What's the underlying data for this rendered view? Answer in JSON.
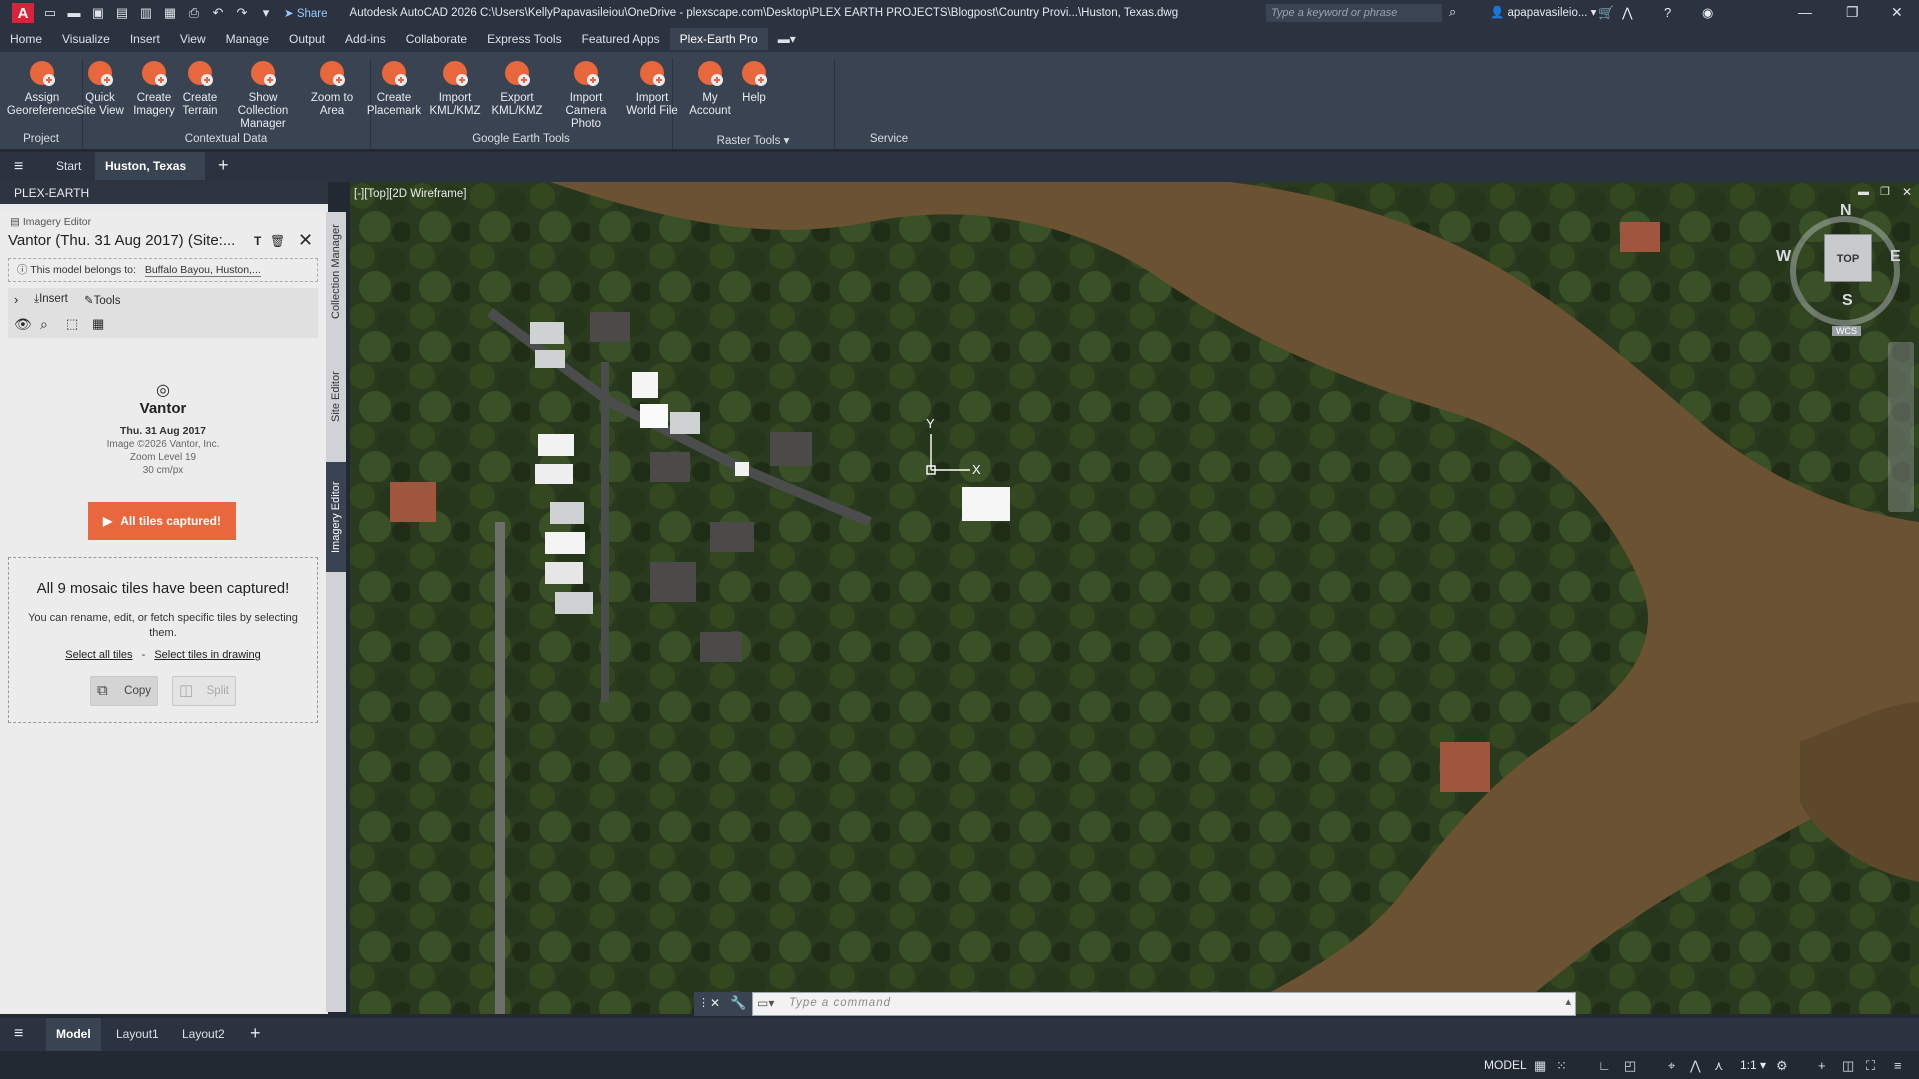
{
  "titlebar": {
    "share_label": "Share",
    "app_title": "Autodesk AutoCAD 2026   C:\\Users\\KellyPapavasileiou\\OneDrive - plexscape.com\\Desktop\\PLEX EARTH PROJECTS\\Blogpost\\Country Provi...\\Huston, Texas.dwg",
    "search_placeholder": "Type a keyword or phrase",
    "user_name": "apapavasileio..."
  },
  "ribbon_tabs": [
    "Home",
    "Visualize",
    "Insert",
    "View",
    "Manage",
    "Output",
    "Add-ins",
    "Collaborate",
    "Express Tools",
    "Featured Apps",
    "Plex-Earth Pro"
  ],
  "ribbon_active_tab": "Plex-Earth Pro",
  "ribbon": {
    "buttons": [
      {
        "l1": "Assign",
        "l2": "Georeference",
        "icon": "georeference-icon"
      },
      {
        "l1": "Quick",
        "l2": "Site View",
        "icon": "site-view-icon"
      },
      {
        "l1": "Create",
        "l2": "Imagery",
        "icon": "imagery-icon"
      },
      {
        "l1": "Create",
        "l2": "Terrain",
        "icon": "terrain-icon"
      },
      {
        "l1": "Show Collection",
        "l2": "Manager",
        "icon": "collection-manager-icon"
      },
      {
        "l1": "Zoom to",
        "l2": "Area",
        "icon": "zoom-area-icon"
      },
      {
        "l1": "Create",
        "l2": "Placemark",
        "icon": "placemark-icon"
      },
      {
        "l1": "Import",
        "l2": "KML/KMZ",
        "icon": "import-kml-icon"
      },
      {
        "l1": "Export",
        "l2": "KML/KMZ",
        "icon": "export-kml-icon"
      },
      {
        "l1": "Import",
        "l2": "Camera Photo",
        "icon": "camera-photo-icon"
      },
      {
        "l1": "Import",
        "l2": "World File",
        "icon": "world-file-icon"
      },
      {
        "l1": "My",
        "l2": "Account",
        "icon": "account-icon"
      },
      {
        "l1": "Help",
        "l2": "",
        "icon": "help-icon"
      }
    ],
    "groups": [
      "Project",
      "Contextual Data",
      "Google Earth Tools",
      "Raster Tools",
      "Service"
    ]
  },
  "doc_tabs": {
    "start": "Start",
    "active": "Huston, Texas"
  },
  "palette": {
    "title": "PLEX-EARTH",
    "editor_label": "Imagery Editor",
    "model_title": "Vantor (Thu. 31 Aug 2017) (Site:...",
    "belongs_label": "This model belongs to:",
    "belongs_value": "Buffalo Bayou, Huston,...",
    "insert_label": "Insert",
    "tools_label": "Tools",
    "provider": "Vantor",
    "date": "Thu. 31 Aug 2017",
    "copyright": "Image ©2026 Vantor, Inc.",
    "zoom": "Zoom Level 19",
    "resolution": "30 cm/px",
    "capture_button": "All tiles captured!",
    "mosaic_heading": "All 9 mosaic tiles have been captured!",
    "mosaic_text": "You can rename, edit, or fetch specific tiles by selecting them.",
    "select_all": "Select all tiles",
    "separator": "-",
    "select_drawing": "Select tiles in drawing",
    "copy_label": "Copy",
    "split_label": "Split",
    "side_tabs": [
      "Collection Manager",
      "Site Editor",
      "Imagery Editor"
    ]
  },
  "viewport": {
    "label": "[-][Top][2D Wireframe]",
    "compass": {
      "n": "N",
      "s": "S",
      "e": "E",
      "w": "W",
      "top": "TOP",
      "wcs": "WCS"
    },
    "ucs_x": "X",
    "ucs_y": "Y"
  },
  "command_line": {
    "placeholder": "Type  a  command"
  },
  "layout_tabs": [
    "Model",
    "Layout1",
    "Layout2"
  ],
  "status": {
    "model": "MODEL",
    "scale": "1:1"
  },
  "colors": {
    "accent": "#e8673c",
    "ribbon_bg": "#3a4352",
    "dark_bg": "#2b3340",
    "water": "#6b5233"
  }
}
